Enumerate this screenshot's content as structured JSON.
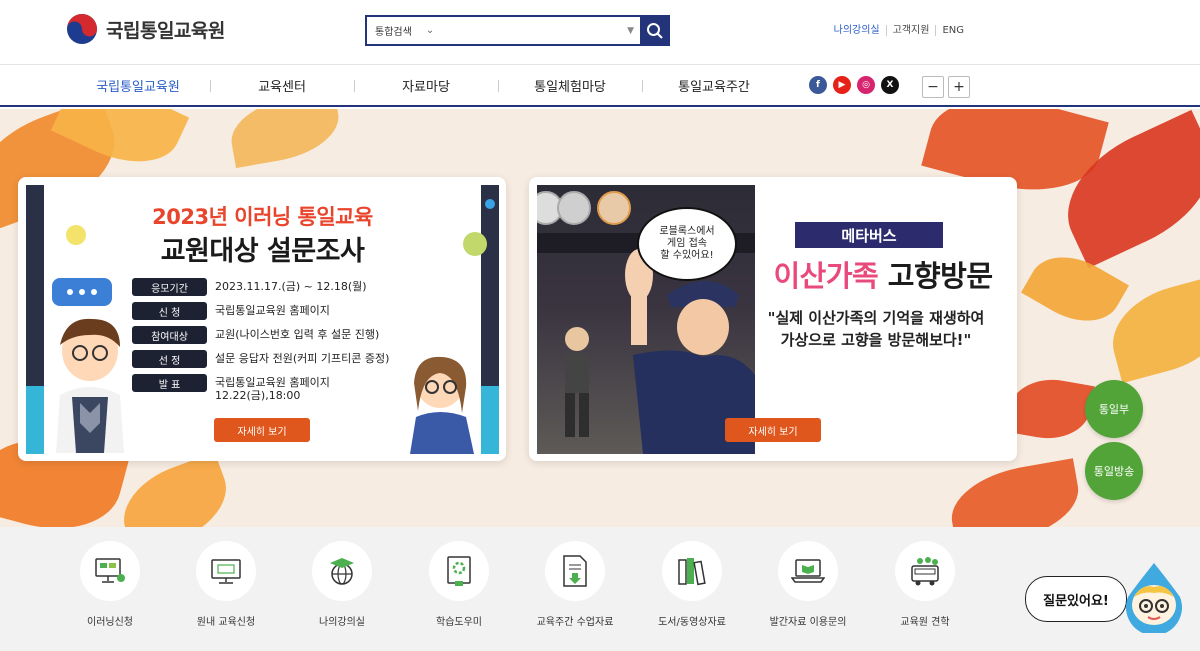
{
  "header": {
    "logo_text": "국립통일교육원",
    "search": {
      "select_label": "통합검색",
      "placeholder": ""
    },
    "util_links": [
      "나의강의실",
      "고객지원",
      "ENG"
    ]
  },
  "gnb": {
    "items": [
      "국립통일교육원",
      "교육센터",
      "자료마당",
      "통일체험마당",
      "통일교육주간"
    ]
  },
  "banner1": {
    "title1": "2023년 이러닝 통일교육",
    "title2": "교원대상 설문조사",
    "rows": [
      {
        "label": "응모기간",
        "value": "2023.11.17.(금) ~ 12.18(월)"
      },
      {
        "label": "신    청",
        "value": "국립통일교육원 홈페이지"
      },
      {
        "label": "참여대상",
        "value": "교원(나이스번호 입력 후 설문 진행)"
      },
      {
        "label": "선    정",
        "value": "설문 응답자 전원(커피 기프티콘 증정)"
      },
      {
        "label": "발    표",
        "value": "국립통일교육원 홈페이지\n12.22(금),18:00"
      }
    ],
    "button": "자세히 보기"
  },
  "banner2": {
    "bubble": "로블록스에서\n게임 접속\n할 수있어요!",
    "tag": "메타버스",
    "title_pink": "이산가족",
    "title_dark": "고향방문",
    "subtitle": "\"실제 이산가족의 기억을 재생하여\n가상으로 고향을 방문해보다!\"",
    "button": "자세히 보기"
  },
  "side_buttons": [
    "통일부",
    "통일방송"
  ],
  "quick_menu": [
    {
      "label": "이러닝신청",
      "icon": "monitor-elearning-icon"
    },
    {
      "label": "원내 교육신청",
      "icon": "edu-monitor-icon"
    },
    {
      "label": "나의강의실",
      "icon": "graduation-globe-icon"
    },
    {
      "label": "학습도우미",
      "icon": "book-gear-icon"
    },
    {
      "label": "교육주간 수업자료",
      "icon": "document-download-icon"
    },
    {
      "label": "도서/동영상자료",
      "icon": "books-icon"
    },
    {
      "label": "발간자료 이용문의",
      "icon": "laptop-book-icon"
    },
    {
      "label": "교육원 견학",
      "icon": "bus-people-icon"
    }
  ],
  "chat": {
    "label": "질문있어요!"
  },
  "colors": {
    "navy": "#23347a",
    "accent_blue": "#2b5cc9",
    "orange": "#e0571d",
    "green": "#52a338"
  }
}
